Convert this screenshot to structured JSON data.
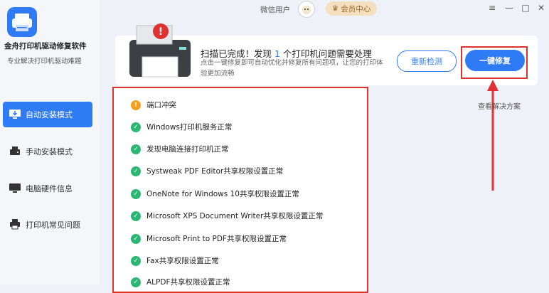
{
  "app": {
    "title": "金舟打印机驱动修复软件",
    "subtitle": "专业解决打印机驱动难题"
  },
  "nav": [
    {
      "label": "自动安装模式",
      "icon": "auto-install-icon",
      "active": true
    },
    {
      "label": "手动安装模式",
      "icon": "manual-install-icon",
      "active": false
    },
    {
      "label": "电脑硬件信息",
      "icon": "monitor-icon",
      "active": false
    },
    {
      "label": "打印机常见问题",
      "icon": "printer-faq-icon",
      "active": false
    }
  ],
  "topbar": {
    "user": "微信用户",
    "vip": "会员中心",
    "vip_icon": "crown-icon",
    "controls": [
      "≡",
      "—",
      "□",
      "✕"
    ]
  },
  "banner": {
    "title_prefix": "扫描已完成！发现 ",
    "count": "1",
    "title_suffix": " 个打印机问题需要处理",
    "desc": "点击一键修复即可自动优化并修复所有问题项，让您的打印体验更加流畅",
    "recheck": "重新检测",
    "repair": "一键修复",
    "solution": "查看解决方案"
  },
  "colors": {
    "accent": "#2f7bf6",
    "ok": "#2bb673",
    "warn": "#f59f1c",
    "highlight": "#e03131"
  },
  "results": [
    {
      "text": "端口冲突",
      "status": "warn"
    },
    {
      "text": "Windows打印机服务正常",
      "status": "ok"
    },
    {
      "text": "发现电脑连接打印机正常",
      "status": "ok"
    },
    {
      "text": "Systweak PDF Editor共享权限设置正常",
      "status": "ok"
    },
    {
      "text": "OneNote for Windows 10共享权限设置正常",
      "status": "ok"
    },
    {
      "text": "Microsoft XPS Document Writer共享权限设置正常",
      "status": "ok"
    },
    {
      "text": "Microsoft Print to PDF共享权限设置正常",
      "status": "ok"
    },
    {
      "text": "Fax共享权限设置正常",
      "status": "ok"
    },
    {
      "text": "ALPDF共享权限设置正常",
      "status": "ok"
    }
  ]
}
